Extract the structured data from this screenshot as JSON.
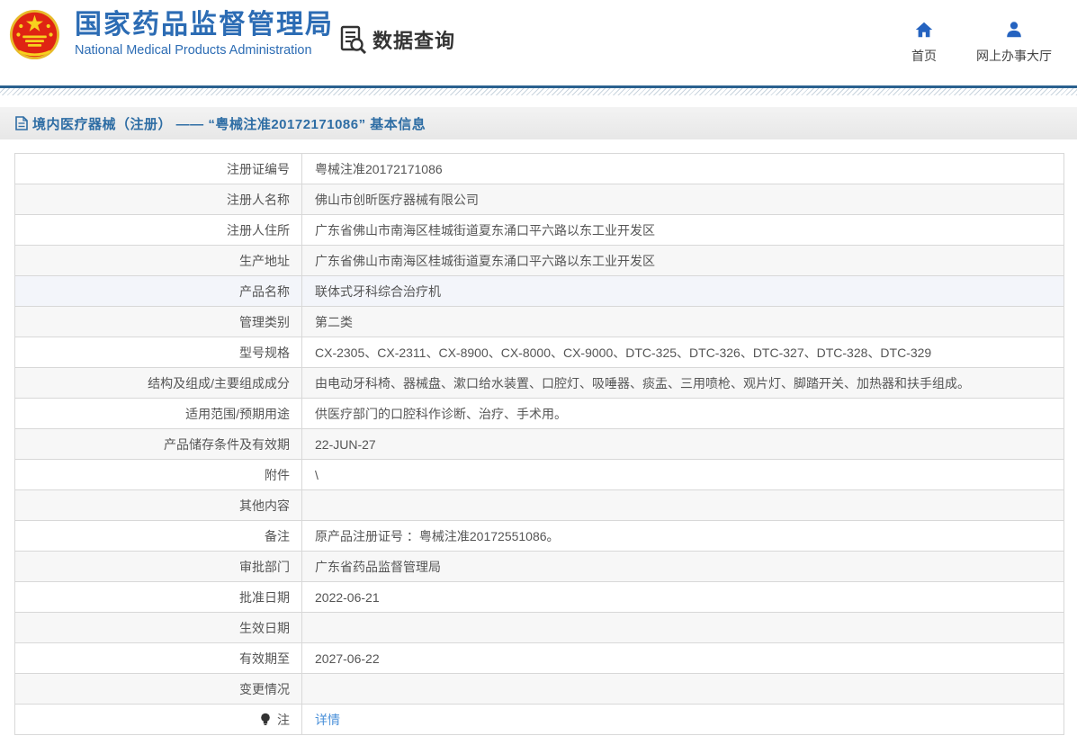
{
  "header": {
    "logo": {
      "title_cn": "国家药品监督管理局",
      "title_en": "National Medical Products Administration"
    },
    "section_label": "数据查询",
    "nav": [
      {
        "label": "首页",
        "icon": "home-icon"
      },
      {
        "label": "网上办事大厅",
        "icon": "user-icon"
      }
    ]
  },
  "breadcrumb": {
    "title": "境内医疗器械（注册） —— “粤械注准20172171086” 基本信息"
  },
  "table": {
    "rows": [
      {
        "label": "注册证编号",
        "value": "粤械注准20172171086"
      },
      {
        "label": "注册人名称",
        "value": "佛山市创昕医疗器械有限公司"
      },
      {
        "label": "注册人住所",
        "value": "广东省佛山市南海区桂城街道夏东涌口平六路以东工业开发区"
      },
      {
        "label": "生产地址",
        "value": "广东省佛山市南海区桂城街道夏东涌口平六路以东工业开发区"
      },
      {
        "label": "产品名称",
        "value": "联体式牙科综合治疗机",
        "highlighted": true
      },
      {
        "label": "管理类别",
        "value": "第二类"
      },
      {
        "label": "型号规格",
        "value": "CX-2305、CX-2311、CX-8900、CX-8000、CX-9000、DTC-325、DTC-326、DTC-327、DTC-328、DTC-329"
      },
      {
        "label": "结构及组成/主要组成成分",
        "value": "由电动牙科椅、器械盘、漱口给水装置、口腔灯、吸唾器、痰盂、三用喷枪、观片灯、脚踏开关、加热器和扶手组成。"
      },
      {
        "label": "适用范围/预期用途",
        "value": "供医疗部门的口腔科作诊断、治疗、手术用。"
      },
      {
        "label": "产品储存条件及有效期",
        "value": "22-JUN-27"
      },
      {
        "label": "附件",
        "value": "\\"
      },
      {
        "label": "其他内容",
        "value": ""
      },
      {
        "label": "备注",
        "value": "原产品注册证号 ：粤械注准20172551086。"
      },
      {
        "label": "审批部门",
        "value": "广东省药品监督管理局"
      },
      {
        "label": "批准日期",
        "value": "2022-06-21"
      },
      {
        "label": "生效日期",
        "value": ""
      },
      {
        "label": "有效期至",
        "value": "2027-06-22"
      },
      {
        "label": "变更情况",
        "value": ""
      },
      {
        "label": "注",
        "label_icon": "bulb-icon",
        "value": "详情",
        "link": true
      }
    ]
  },
  "colors": {
    "brand_blue": "#2c6cb4",
    "header_rule": "#2a618f",
    "title_text": "#2e6da4",
    "link": "#4a90d9",
    "row_alt": "#f7f7f7",
    "row_hover": "#f3f5fa",
    "border": "#d8d8d8"
  }
}
